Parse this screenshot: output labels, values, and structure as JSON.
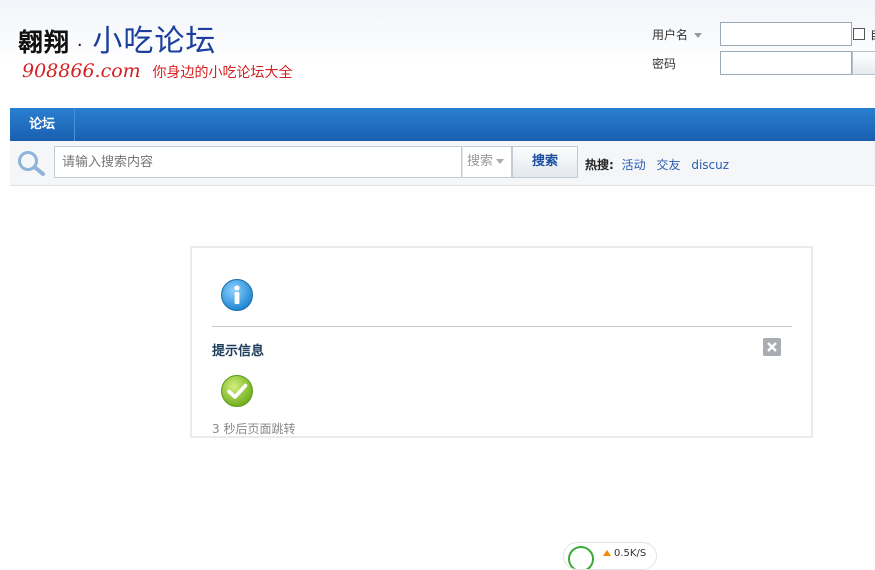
{
  "header": {
    "logo": {
      "brand": "翱翔",
      "separator": "·",
      "title": "小吃论坛",
      "domain": "908866.com",
      "tagline": "你身边的小吃论坛大全"
    },
    "login": {
      "username_label": "用户名",
      "password_label": "密码",
      "username_value": "",
      "password_value": "",
      "remember_label": "自"
    }
  },
  "nav": {
    "items": [
      {
        "label": "论坛"
      }
    ]
  },
  "search": {
    "placeholder": "请输入搜索内容",
    "type_selected": "搜索",
    "button_label": "搜索",
    "hot_label": "热搜:",
    "hot_links": [
      "活动",
      "交友",
      "discuz"
    ]
  },
  "message": {
    "title": "提示信息",
    "redirect_text": "3 秒后页面跳转"
  },
  "bottom_widget": {
    "text": "0.5K/S"
  },
  "colors": {
    "nav_blue": "#1f6cc0",
    "title_dark_blue": "#1e3d5c",
    "logo_red": "#d42020",
    "logo_blue": "#1b3f9c",
    "link_blue": "#2a5db0",
    "check_green": "#8cc63f",
    "info_blue": "#3b9de0"
  },
  "icons": {
    "search": "magnifier-icon",
    "info": "info-circle-icon",
    "success": "checkmark-circle-icon",
    "close": "close-x-icon"
  }
}
